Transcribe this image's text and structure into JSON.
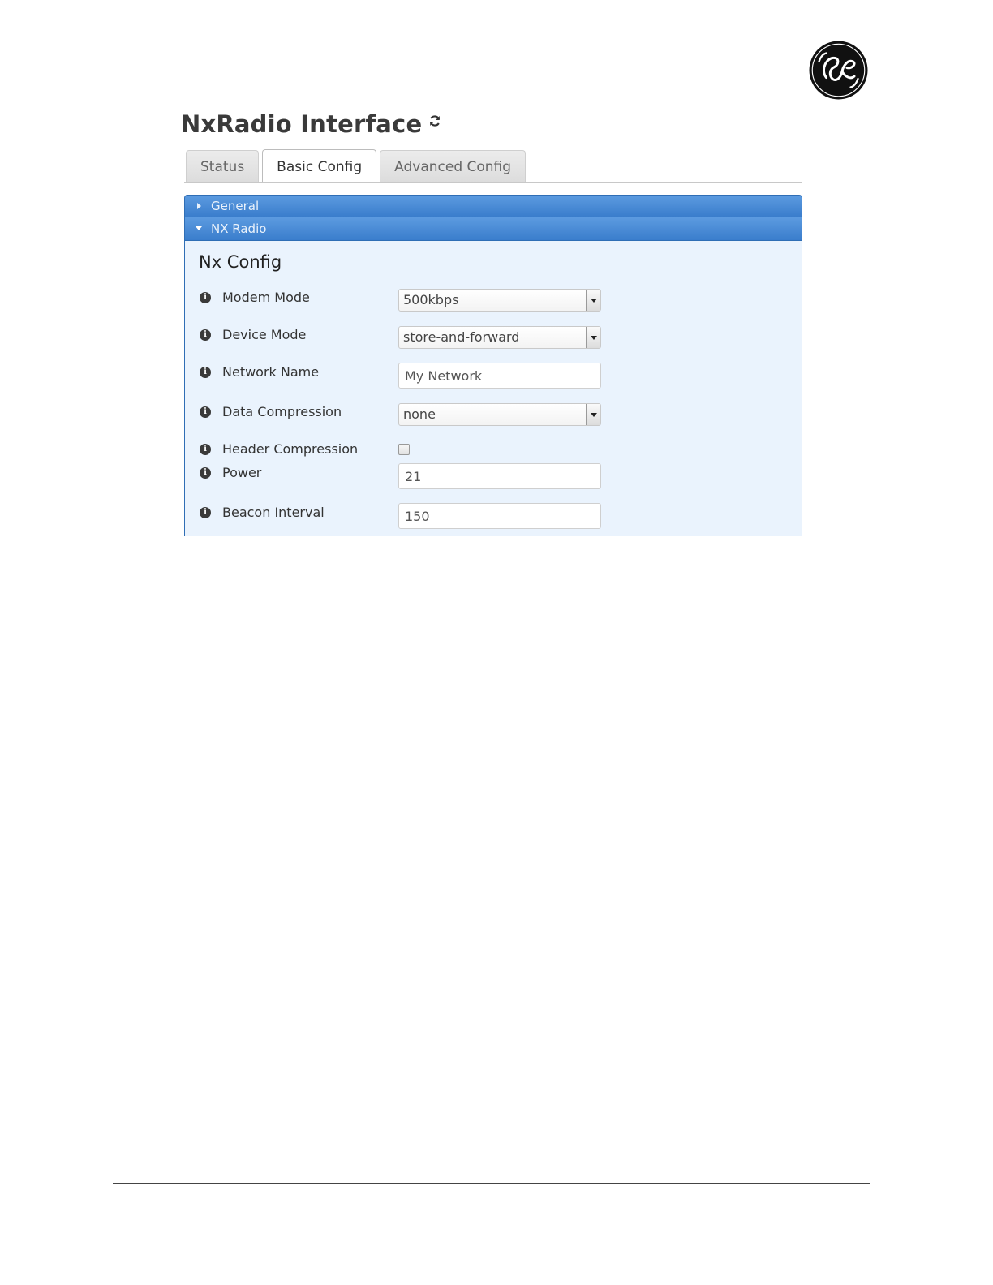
{
  "page": {
    "title": "NxRadio Interface"
  },
  "tabs": [
    {
      "label": "Status",
      "active": false
    },
    {
      "label": "Basic Config",
      "active": true
    },
    {
      "label": "Advanced Config",
      "active": false
    }
  ],
  "accordion": {
    "general": {
      "label": "General",
      "expanded": false
    },
    "nx_radio": {
      "label": "NX Radio",
      "expanded": true
    }
  },
  "section": {
    "title": "Nx Config"
  },
  "fields": {
    "modem_mode": {
      "label": "Modem Mode",
      "value": "500kbps"
    },
    "device_mode": {
      "label": "Device Mode",
      "value": "store-and-forward"
    },
    "network_name": {
      "label": "Network Name",
      "value": "My Network"
    },
    "data_compression": {
      "label": "Data Compression",
      "value": "none"
    },
    "header_compression": {
      "label": "Header Compression",
      "checked": false
    },
    "power": {
      "label": "Power",
      "value": "21"
    },
    "beacon_interval": {
      "label": "Beacon Interval",
      "value": "150"
    }
  },
  "icons": {
    "info": "info-icon",
    "refresh": "refresh-icon",
    "logo": "ge-logo"
  },
  "colors": {
    "accordion_header": "#3a7dcc",
    "accordion_body": "#eaf3fd"
  }
}
